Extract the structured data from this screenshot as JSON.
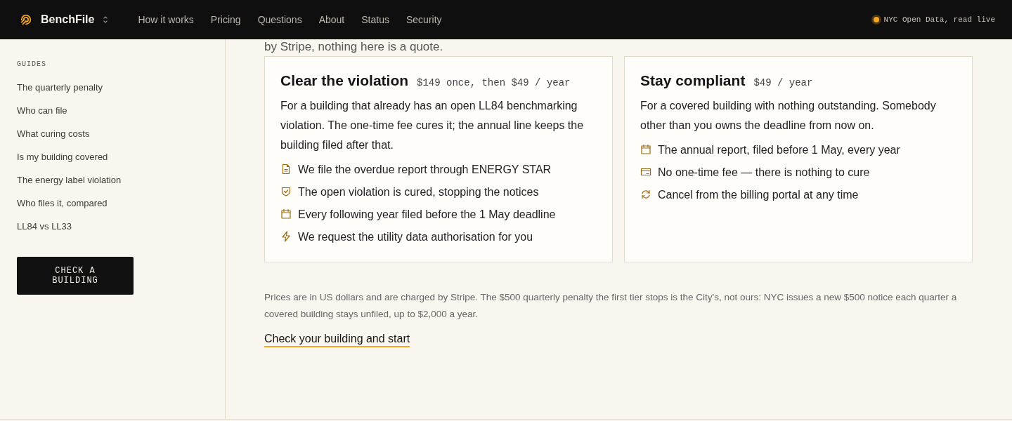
{
  "header": {
    "brand": "BenchFile",
    "nav": [
      "How it works",
      "Pricing",
      "Questions",
      "About",
      "Status",
      "Security"
    ],
    "status": {
      "text": "NYC Open Data, read live",
      "color": "#f5a623"
    }
  },
  "sidebar": {
    "heading": "GUIDES",
    "items": [
      "The quarterly penalty",
      "Who can file",
      "What curing costs",
      "Is my building covered",
      "The energy label violation",
      "Who files it, compared",
      "LL84 vs LL33"
    ],
    "button": "CHECK A BUILDING"
  },
  "intro": "by Stripe, nothing here is a quote.",
  "plans": [
    {
      "title": "Clear the violation",
      "price": "$149 once, then $49 / year",
      "description": "For a building that already has an open LL84 benchmarking violation. The one-time fee cures it; the annual line keeps the building filed after that.",
      "features": [
        {
          "kind": "document",
          "text": "We file the overdue report through ENERGY STAR"
        },
        {
          "kind": "shield",
          "text": "The open violation is cured, stopping the notices"
        },
        {
          "kind": "calendar",
          "text": "Every following year filed before the 1 May deadline"
        },
        {
          "kind": "bolt",
          "text": "We request the utility data authorisation for you"
        }
      ]
    },
    {
      "title": "Stay compliant",
      "price": "$49 / year",
      "description": "For a covered building with nothing outstanding. Somebody other than you owns the deadline from now on.",
      "features": [
        {
          "kind": "calendar",
          "text": "The annual report, filed before 1 May, every year"
        },
        {
          "kind": "card",
          "text": "No one-time fee — there is nothing to cure"
        },
        {
          "kind": "refresh",
          "text": "Cancel from the billing portal at any time"
        }
      ]
    }
  ],
  "note": "Prices are in US dollars and are charged by Stripe. The $500 quarterly penalty the first tier stops is the City's, not ours: NYC issues a new $500 notice each quarter a covered building stays unfiled, up to $2,000 a year.",
  "cta": "Check your building and start"
}
